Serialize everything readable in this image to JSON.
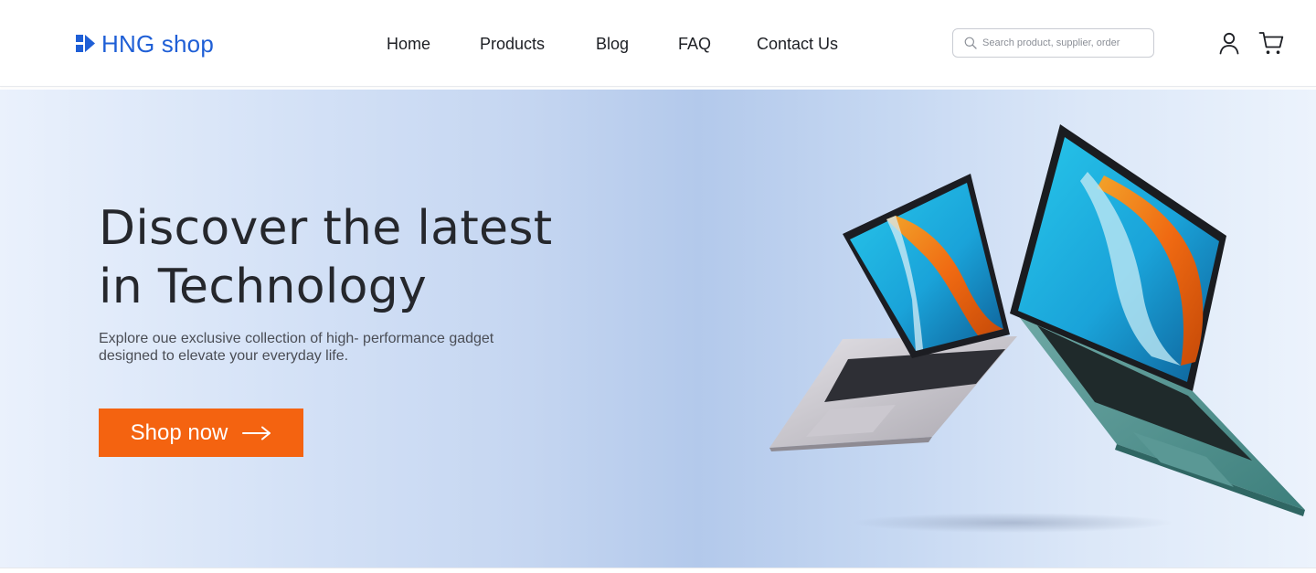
{
  "brand": {
    "name": "HNG shop",
    "color": "#1f5fd6"
  },
  "nav": {
    "items": [
      {
        "label": "Home"
      },
      {
        "label": "Products"
      },
      {
        "label": "Blog"
      },
      {
        "label": "FAQ"
      },
      {
        "label": "Contact Us"
      }
    ]
  },
  "search": {
    "placeholder": "Search product, supplier, order",
    "value": "",
    "icon": "search-icon"
  },
  "header_icons": {
    "account": "user-icon",
    "cart": "cart-icon"
  },
  "hero": {
    "title_line1": "Discover the latest",
    "title_line2": "in Technology",
    "subtitle_line1": "Explore oue exclusive collection of high- performance gadget",
    "subtitle_line2": "designed to elevate your everyday life.",
    "cta_label": "Shop now",
    "cta_icon": "arrow-right-icon",
    "cta_color": "#f46310",
    "image": "two-laptops-illustration"
  }
}
